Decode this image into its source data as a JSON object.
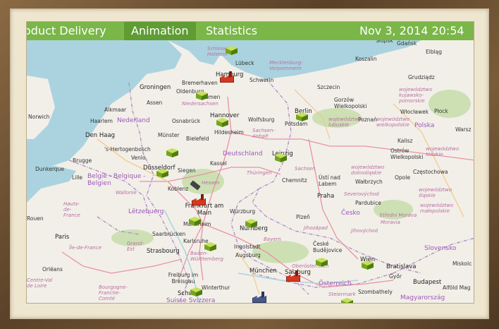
{
  "topbar": {
    "tab_delivery": "oduct Delivery",
    "tab_animation": "Animation",
    "tab_statistics": "Statistics",
    "date": "Nov 3, 2014   20:54"
  },
  "colors": {
    "bar": "#7ab648",
    "active_tab": "#5f9c33",
    "depot": "#8dc63f",
    "factory": "#d4391f"
  },
  "map": {
    "labels": {
      "gdansk": "Gdańsk",
      "elblag": "Elbląg",
      "koszalin": "Koszalin",
      "slupsk": "Słupsk",
      "schleswig": "Schleswig-Holstein",
      "lubeck": "Lübeck",
      "mecklenburg": "Mecklenburg-Vorpommern",
      "hamburg": "Hamburg",
      "bremerhaven": "Bremerhaven",
      "schwerin": "Schwerin",
      "szczecin": "Szczecin",
      "grudziadz": "Grudziądz",
      "groningen": "Groningen",
      "oldenburg": "Oldenburg",
      "bremen": "Bremen",
      "gorzow": "Gorzów Wielkopolski",
      "kujawsko": "województwo kujawsko-pomorskie",
      "alkmaar": "Alkmaar",
      "assen": "Assen",
      "niedersachsen": "Niedersachsen",
      "wlocl": "Włocławek",
      "plock": "Płock",
      "norwich": "Norwich",
      "haarlem": "Haarlem",
      "nederland": "Nederland",
      "osnabruck": "Osnabrück",
      "hannover": "Hannover",
      "wolfsburg": "Wolfsburg",
      "berlin": "Berlin",
      "brandenburg": "Brandenburg",
      "lubuskie": "województwo lubuskie",
      "poznan": "Poznań",
      "wielkopolskie": "województwo wielkopolskie",
      "polska": "Polska",
      "warsz": "Warsz",
      "denhaag": "Den Haag",
      "munster": "Münster",
      "bielefeld": "Bielefeld",
      "hildesheim": "Hildesheim",
      "potsdam": "Potsdam",
      "sachsenanhalt": "Sachsen-Anhalt",
      "kalisz": "Kalisz",
      "hertogenbosch": "'s-Hertogenbosch",
      "venlo": "Venlo",
      "deutschland": "Deutschland",
      "leipzig": "Leipzig",
      "ostrow": "Ostrów Wielkopolski",
      "lodzkie": "województwo łódzkie",
      "brugge": "Brugge",
      "dusseldorf": "Düsseldorf",
      "kassel": "Kassel",
      "sachsen": "Sachsen",
      "dolnoslaskie": "województwo dolnośląskie",
      "czestochowa": "Częstochowa",
      "dunkerque": "Dunkerque",
      "lille": "Lille",
      "belgie": "België - Belgique - Belgien",
      "siegen": "Siegen",
      "thuringen": "Thüringen",
      "chemnitz": "Chemnitz",
      "usti": "Ústí nad Labem",
      "walbrzych": "Wałbrzych",
      "opole": "Opole",
      "koblenz": "Koblenz",
      "hessen": "Hessen",
      "wallonie": "Wallonie",
      "slaskie": "województwo śląskie",
      "praha": "Praha",
      "severovychod": "Severovýchod",
      "pardubice": "Pardubice",
      "hautsdefrance": "Hauts-de-France",
      "frankfurt": "Frankfurt am Main",
      "wurzburg": "Würzburg",
      "letzebuerg": "Lëtzebuerg",
      "plzen": "Plzeň",
      "cesko": "Česko",
      "malopolskie": "województwo małopolskie",
      "rouen": "Rouen",
      "mannheim": "Mannheim",
      "nurnberg": "Nürnberg",
      "saarbrucken": "Saarbrücken",
      "jihozapad": "Jihozápad",
      "jihovychod": "Jihovýchod",
      "moravia": "Moravia",
      "stredni": "Střední Morava",
      "paris": "Paris",
      "karlsruhe": "Karlsruhe",
      "bayern": "Bayern",
      "grandest": "Grand-Est",
      "ingolstadt": "Ingolstadt",
      "ceske": "České Budějovice",
      "slovensko": "Slovensko",
      "strasbourg": "Strasbourg",
      "badenwurt": "Baden-Württemberg",
      "augsburg": "Augsburg",
      "iledefrance": "Île-de-France",
      "wien": "Wien",
      "bratislava": "Bratislava",
      "munchen": "München",
      "salzburg": "Salzburg",
      "oberosterreich": "Oberösterreich",
      "miskolc": "Miskolc",
      "orleans": "Orléans",
      "freiburg": "Freiburg im Breisgau",
      "gyor": "Győr",
      "budapest": "Budapest",
      "centreval": "Centre-Val de Loire",
      "winterthur": "Winterthur",
      "osterreich": "Österreich",
      "alfold": "Alföld Mag",
      "bourgogne": "Bourgogne-Franche-Comté",
      "steiermark": "Steiermark",
      "szombathely": "Szombathely",
      "suisse": "Suisse Svizzera",
      "magyarorszag": "Magyarország",
      "schw": "Schw"
    }
  }
}
